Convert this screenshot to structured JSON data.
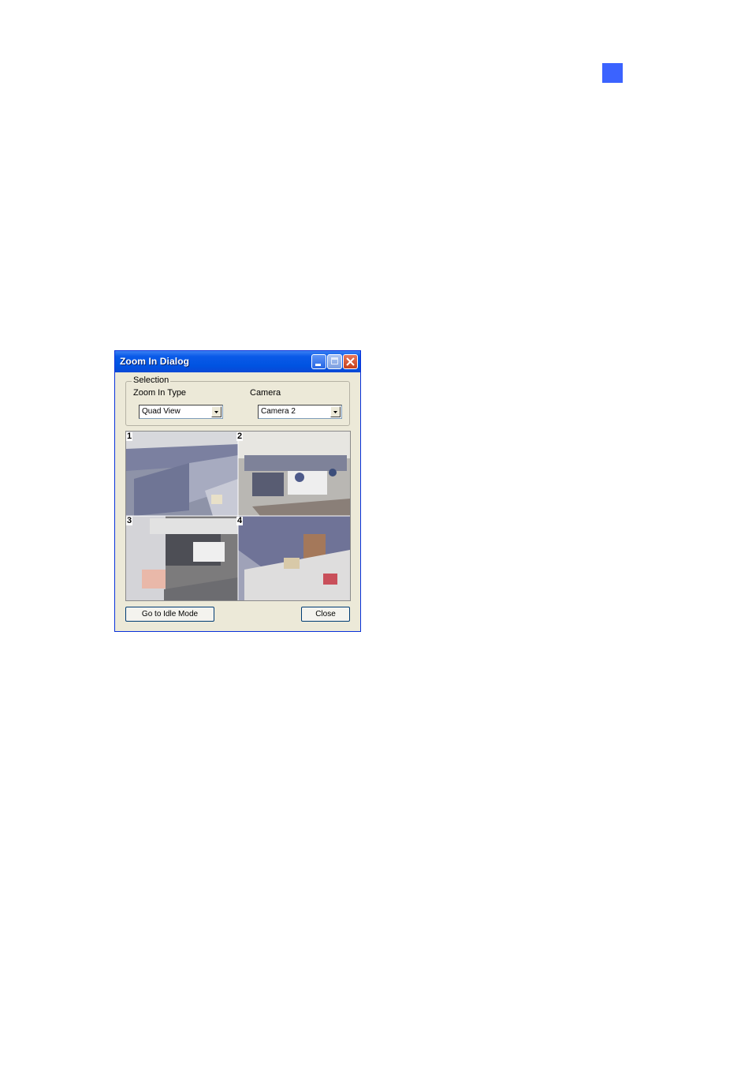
{
  "dialog": {
    "title": "Zoom In Dialog",
    "selection_group": "Selection",
    "zoom_in_type_label": "Zoom In Type",
    "zoom_in_type_value": "Quad View",
    "camera_label": "Camera",
    "camera_value": "Camera 2",
    "quad_labels": [
      "1",
      "2",
      "3",
      "4"
    ],
    "go_idle_button": "Go to Idle Mode",
    "close_button": "Close"
  },
  "icons": {
    "minimize": "minimize-icon",
    "maximize": "maximize-icon",
    "close": "close-icon",
    "dropdown": "chevron-down-icon"
  },
  "colors": {
    "titlebar": "#0053e1",
    "close_button": "#c6401a",
    "dialog_face": "#ece9d8",
    "page_marker": "#3b63ff"
  }
}
